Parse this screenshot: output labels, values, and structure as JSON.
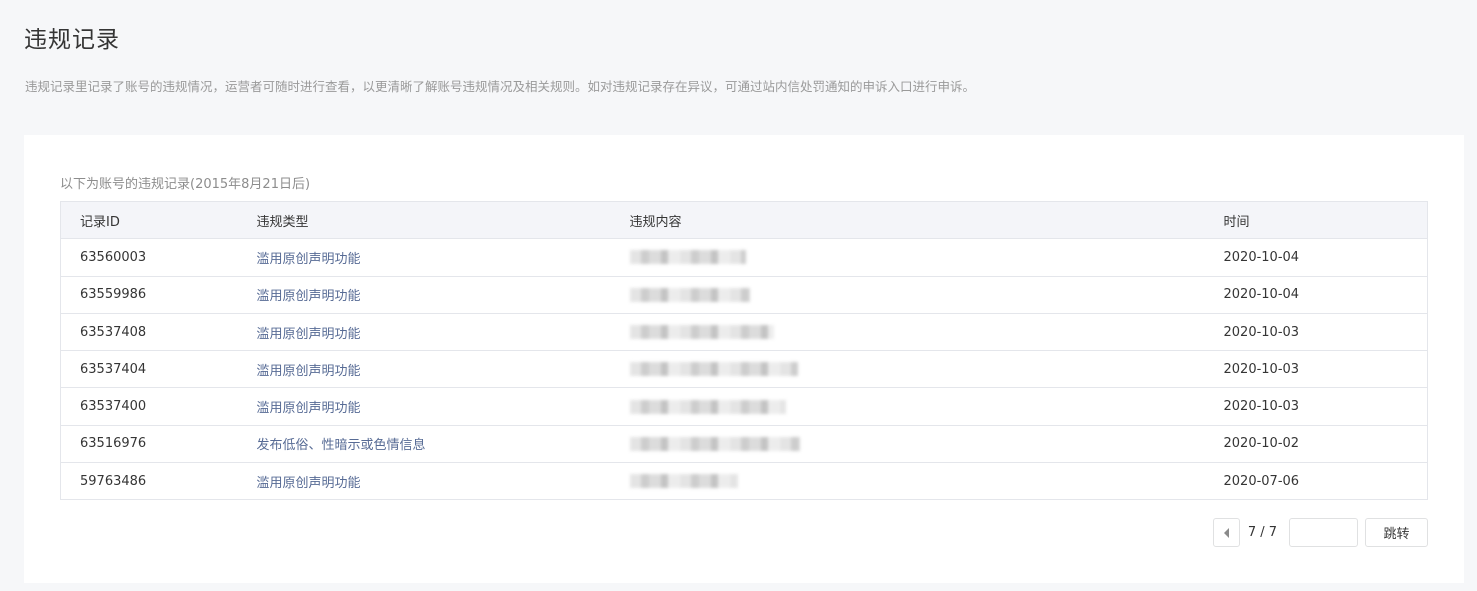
{
  "header": {
    "title": "违规记录",
    "description": "违规记录里记录了账号的违规情况，运营者可随时进行查看，以更清晰了解账号违规情况及相关规则。如对违规记录存在异议，可通过站内信处罚通知的申诉入口进行申诉。"
  },
  "table": {
    "caption": "以下为账号的违规记录(2015年8月21日后)",
    "columns": [
      "记录ID",
      "违规类型",
      "违规内容",
      "时间"
    ],
    "rows": [
      {
        "id": "63560003",
        "type": "滥用原创声明功能",
        "content": "[redacted]",
        "time": "2020-10-04"
      },
      {
        "id": "63559986",
        "type": "滥用原创声明功能",
        "content": "[redacted]",
        "time": "2020-10-04"
      },
      {
        "id": "63537408",
        "type": "滥用原创声明功能",
        "content": "[redacted]",
        "time": "2020-10-03"
      },
      {
        "id": "63537404",
        "type": "滥用原创声明功能",
        "content": "[redacted]",
        "time": "2020-10-03"
      },
      {
        "id": "63537400",
        "type": "滥用原创声明功能",
        "content": "[redacted]",
        "time": "2020-10-03"
      },
      {
        "id": "63516976",
        "type": "发布低俗、性暗示或色情信息",
        "content": "[redacted]",
        "time": "2020-10-02"
      },
      {
        "id": "59763486",
        "type": "滥用原创声明功能",
        "content": "[redacted]",
        "time": "2020-07-06"
      }
    ]
  },
  "pagination": {
    "prev_icon": "caret-left-icon",
    "indicator": "7 / 7",
    "input_value": "",
    "jump_label": "跳转"
  },
  "colors": {
    "background": "#f6f7f9",
    "card": "#ffffff",
    "header_row": "#f4f5f9",
    "link_text": "#576b95",
    "muted_text": "#9a9a9a"
  }
}
